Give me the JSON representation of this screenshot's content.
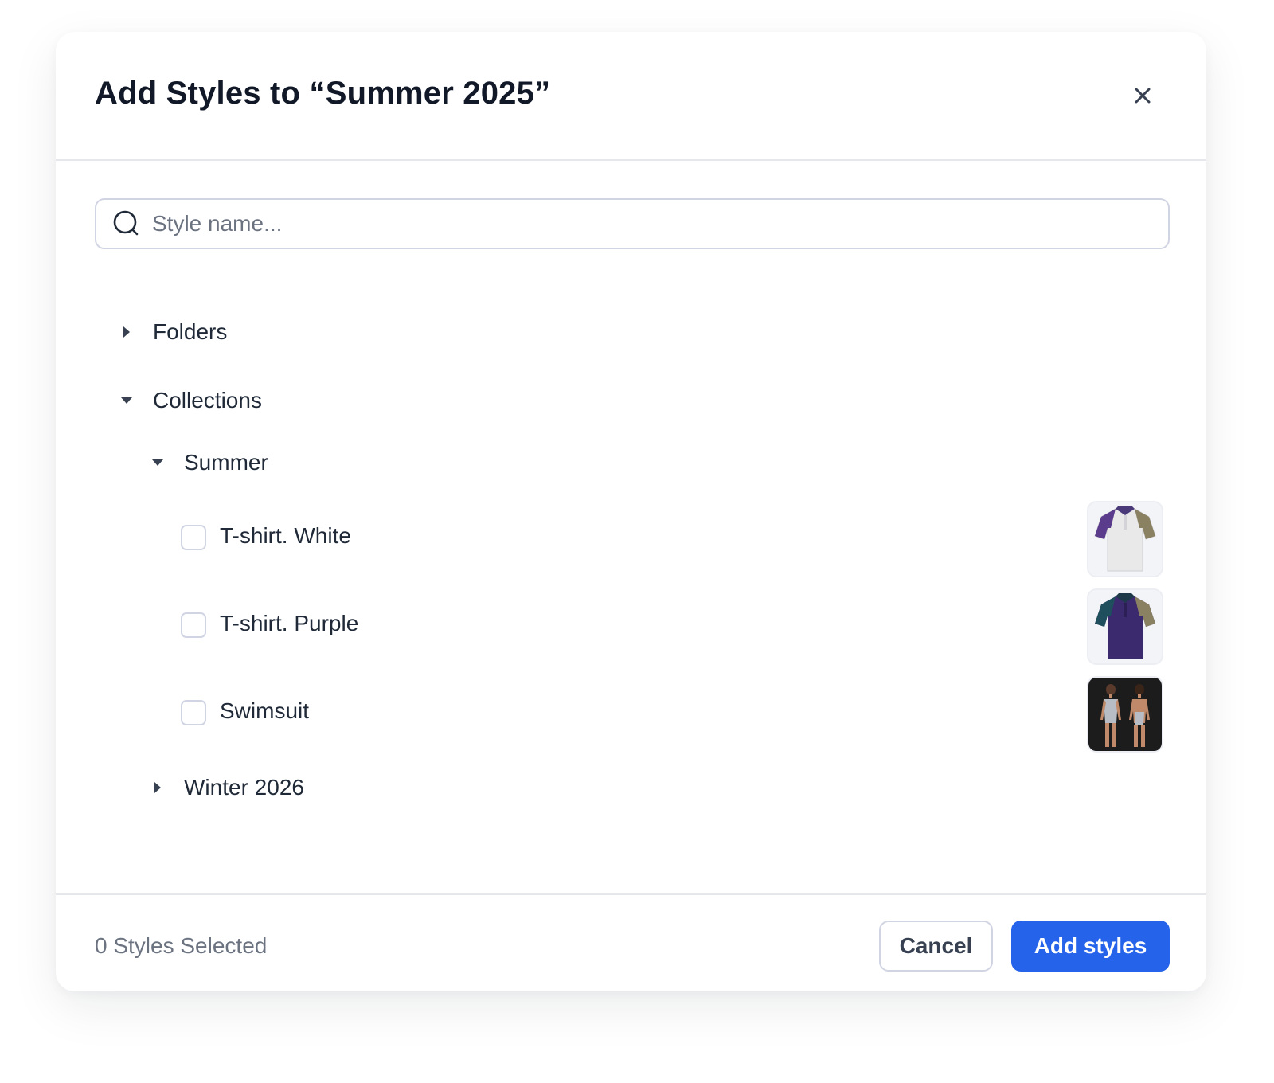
{
  "dialog": {
    "title": "Add Styles to “Summer 2025”",
    "close_icon": "close-icon"
  },
  "search": {
    "placeholder": "Style name...",
    "value": "",
    "icon": "search-icon"
  },
  "tree": {
    "folders": {
      "label": "Folders",
      "expanded": false
    },
    "collections": {
      "label": "Collections",
      "expanded": true,
      "summer": {
        "label": "Summer",
        "expanded": true,
        "styles": [
          {
            "label": "T-shirt. White",
            "checked": false,
            "thumbnail": "white-polo-shirt"
          },
          {
            "label": "T-shirt. Purple",
            "checked": false,
            "thumbnail": "purple-polo-shirt"
          },
          {
            "label": "Swimsuit",
            "checked": false,
            "thumbnail": "swimsuit-front-back"
          }
        ]
      },
      "winter": {
        "label": "Winter 2026",
        "expanded": false
      }
    }
  },
  "footer": {
    "selected_count": "0 Styles Selected",
    "cancel_label": "Cancel",
    "add_label": "Add styles"
  },
  "colors": {
    "primary": "#2563eb",
    "border": "#d1d5e3",
    "text": "#111827",
    "muted": "#6b7280"
  }
}
